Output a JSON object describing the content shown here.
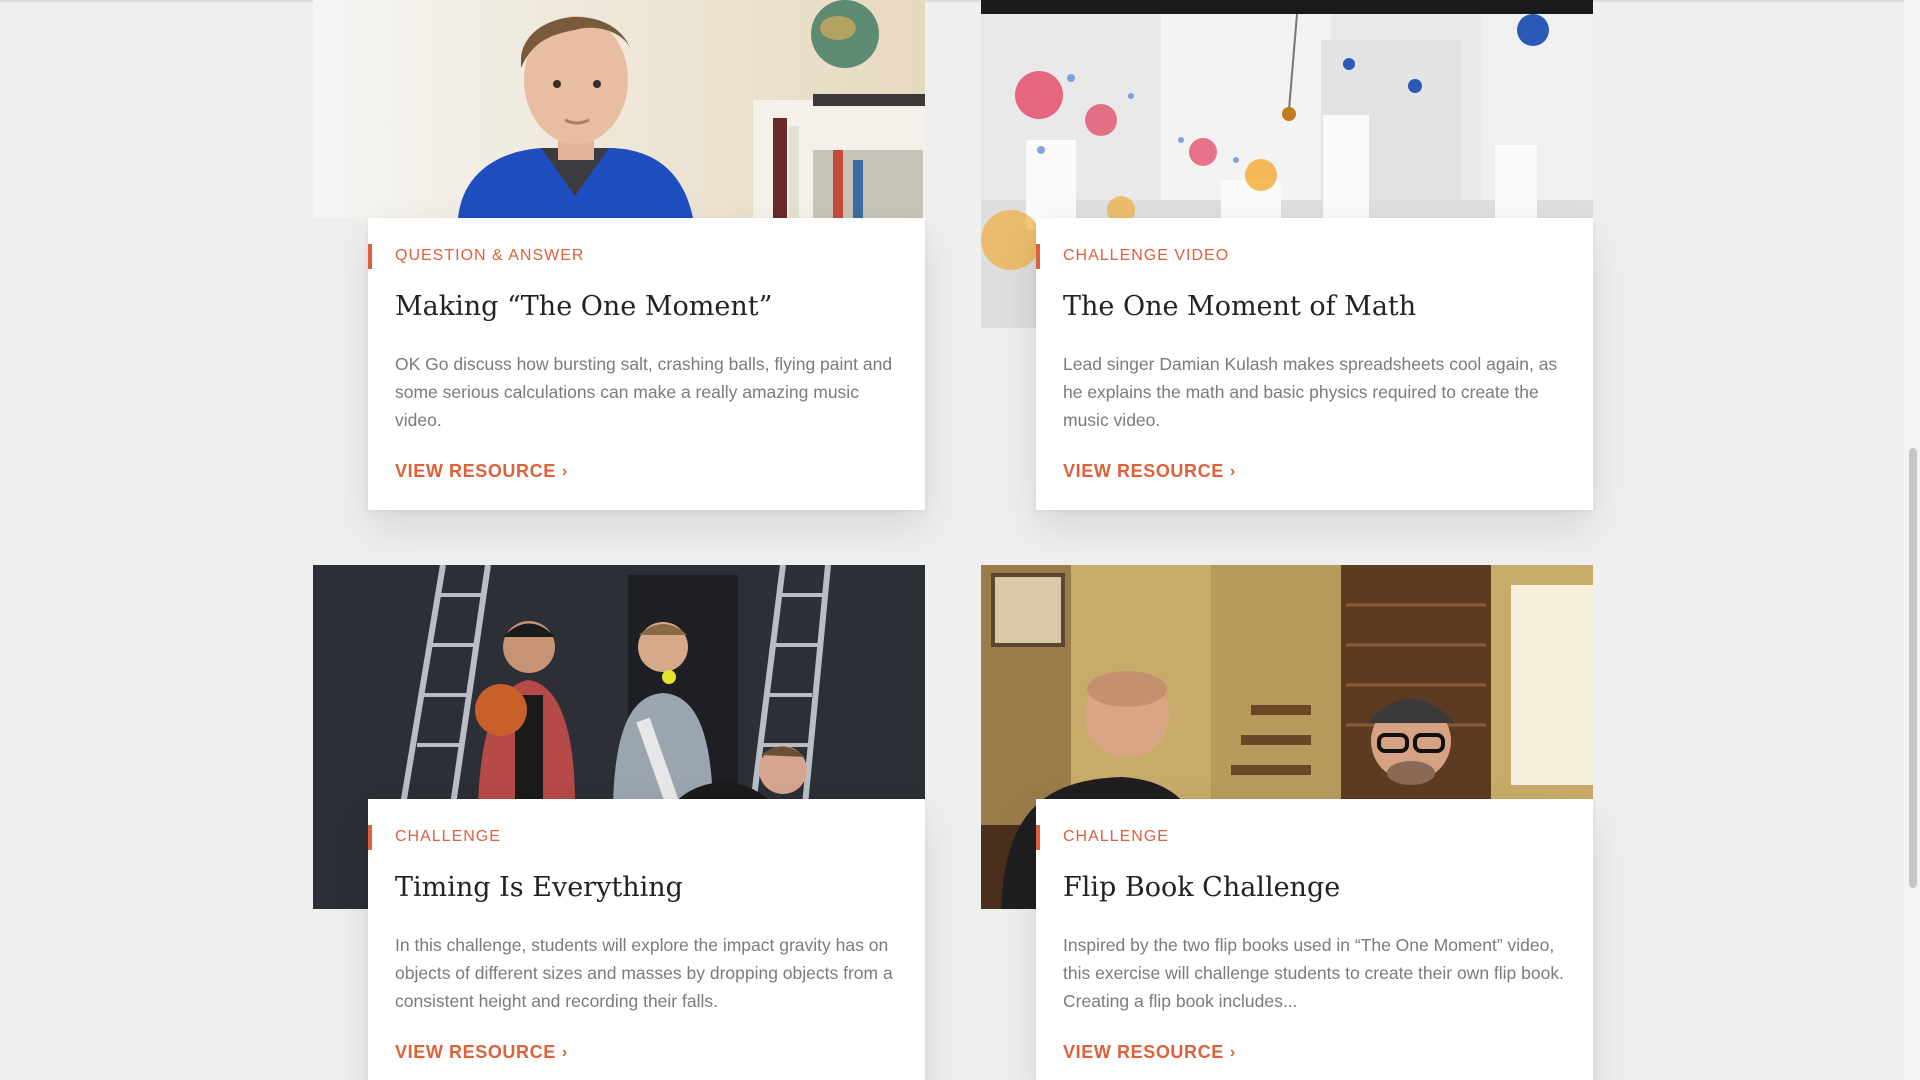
{
  "cards": [
    {
      "tag": "QUESTION & ANSWER",
      "title": "Making “The One Moment”",
      "description": "OK Go discuss how bursting salt, crashing balls, flying paint and some serious calculations can make a really amazing music video.",
      "cta": "VIEW RESOURCE",
      "image": "man-in-blue-hoodie-interview-photo"
    },
    {
      "tag": "CHALLENGE VIDEO",
      "title": "The One Moment of Math",
      "description": "Lead singer Damian Kulash makes spreadsheets cool again, as he explains the math and basic physics required to create the music video.",
      "cta": "VIEW RESOURCE",
      "image": "exploding-paint-white-set-photo"
    },
    {
      "tag": "CHALLENGE",
      "title": "Timing Is Everything",
      "description": "In this challenge, students will explore the impact gravity has on objects of different sizes and masses by dropping objects from a consistent height and recording their falls.",
      "cta": "VIEW RESOURCE",
      "image": "band-with-ladders-and-basketball-photo"
    },
    {
      "tag": "CHALLENGE",
      "title": "Flip Book Challenge",
      "description": "Inspired by the two flip books used in “The One Moment” video, this exercise will challenge students to create their own flip book. Creating a flip book includes...",
      "cta": "VIEW RESOURCE",
      "image": "two-men-laughing-at-table-photo"
    }
  ],
  "colors": {
    "accent": "#e0603a",
    "page_bg": "#efefef",
    "title": "#222222",
    "body_text": "#7b7b7b"
  }
}
